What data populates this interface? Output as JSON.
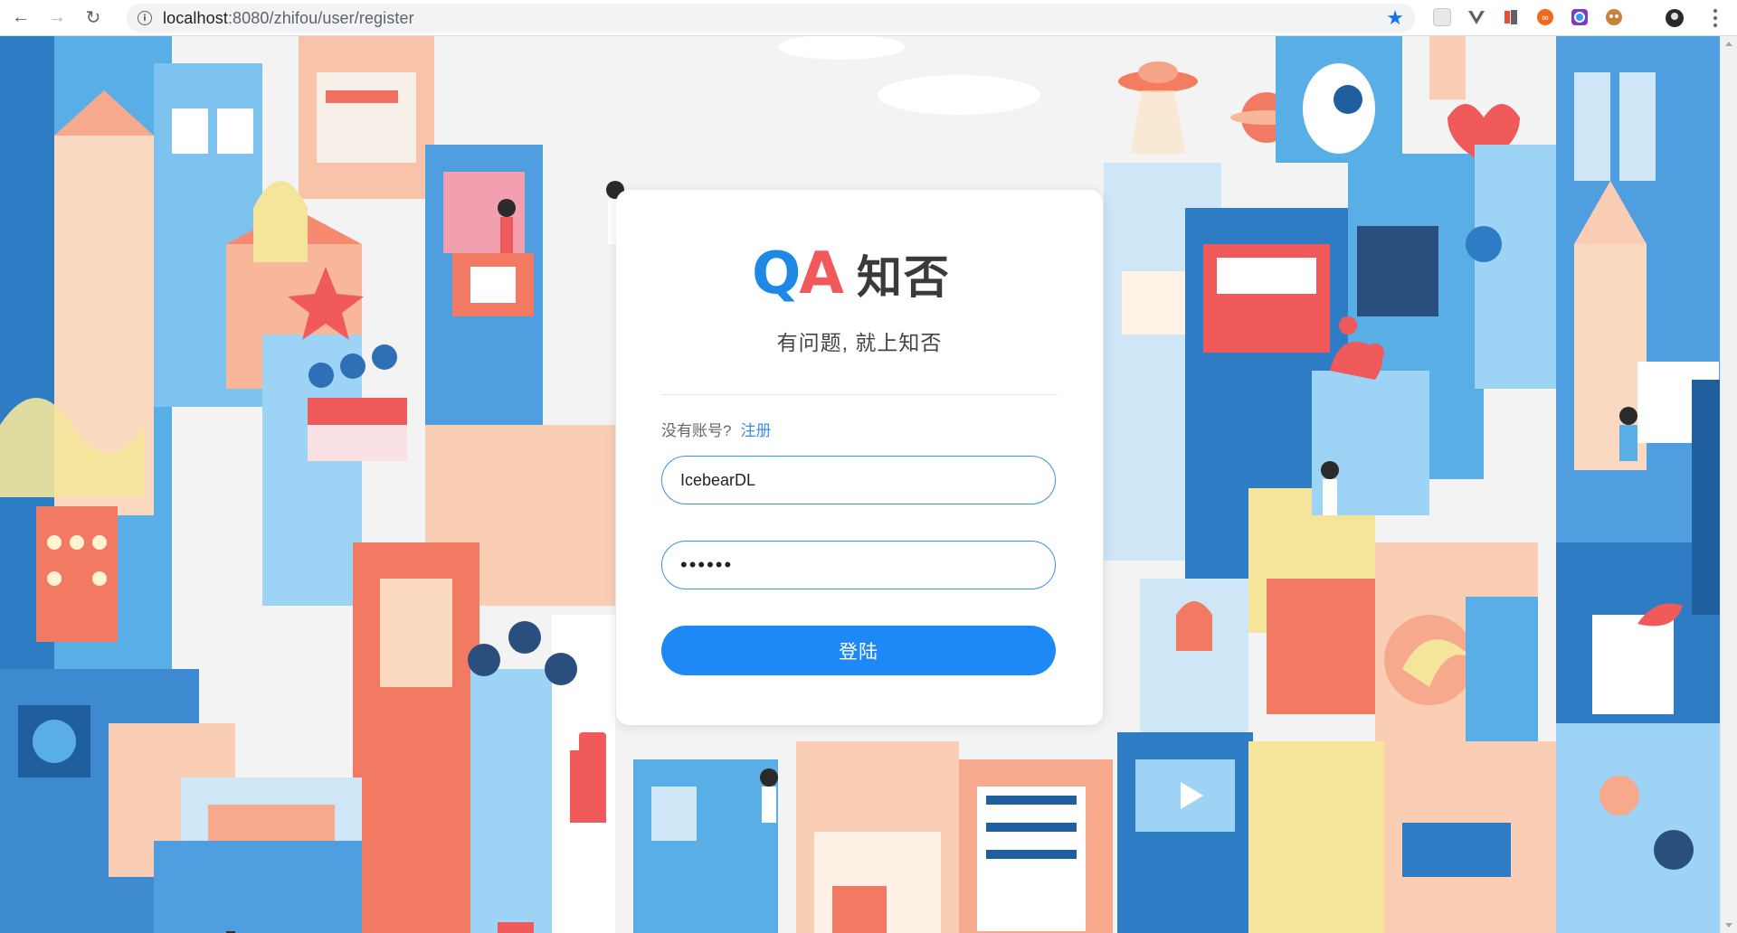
{
  "browser": {
    "url_host": "localhost",
    "url_path": ":8080/zhifou/user/register"
  },
  "logo": {
    "mark_q": "Q",
    "mark_a": "A",
    "text": "知否"
  },
  "slogan": "有问题, 就上知否",
  "register_prompt": {
    "label": "没有账号?",
    "link": "注册"
  },
  "form": {
    "username_value": "IcebearDL",
    "password_value": "••••••",
    "submit_label": "登陆"
  },
  "colors": {
    "accent": "#1e88f5",
    "logo_q": "#1e88e5",
    "logo_a": "#f15a5a"
  }
}
